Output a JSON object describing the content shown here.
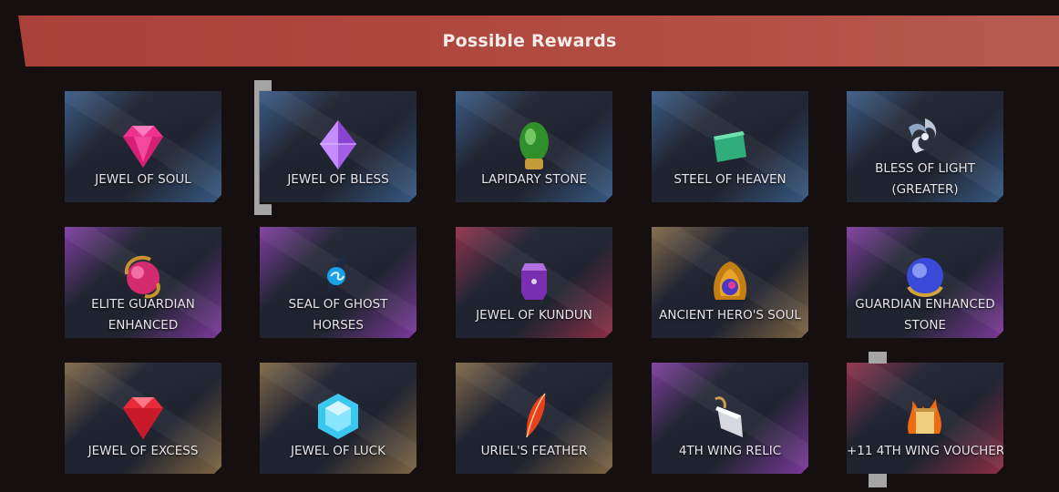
{
  "header": {
    "title": "Possible Rewards"
  },
  "rewards": [
    {
      "name": "JEWEL OF SOUL",
      "icon": "pink-diamond-icon",
      "tint": "#3d6aa0"
    },
    {
      "name": "JEWEL OF BLESS",
      "icon": "purple-crystal-icon",
      "tint": "#3d6aa0"
    },
    {
      "name": "LAPIDARY STONE",
      "icon": "green-egg-stone-icon",
      "tint": "#3d6aa0"
    },
    {
      "name": "STEEL OF HEAVEN",
      "icon": "green-cube-icon",
      "tint": "#3d6aa0"
    },
    {
      "name": "BLESS OF LIGHT",
      "name2": "(GREATER)",
      "icon": "silver-swirl-icon",
      "tint": "#3d6aa0"
    },
    {
      "name": "ELITE GUARDIAN",
      "name2": "ENHANCED",
      "icon": "pink-orb-gold-icon",
      "tint": "#9a3fc0"
    },
    {
      "name": "SEAL OF GHOST",
      "name2": "HORSES",
      "icon": "blue-feather-seal-icon",
      "tint": "#9a3fc0"
    },
    {
      "name": "JEWEL OF KUNDUN",
      "icon": "purple-gem-box-icon",
      "tint": "#b0304e"
    },
    {
      "name": "ANCIENT HERO'S SOUL",
      "icon": "golden-relic-orb-icon",
      "tint": "#9c7a4a"
    },
    {
      "name": "GUARDIAN ENHANCED",
      "name2": "STONE",
      "icon": "blue-orb-gold-icon",
      "tint": "#9a3fc0"
    },
    {
      "name": "JEWEL OF EXCESS",
      "icon": "red-diamond-icon",
      "tint": "#9c7a4a"
    },
    {
      "name": "JEWEL OF LUCK",
      "icon": "cyan-hexagon-gem-icon",
      "tint": "#9c7a4a"
    },
    {
      "name": "URIEL'S FEATHER",
      "icon": "red-feather-icon",
      "tint": "#9c7a4a"
    },
    {
      "name": "4TH WING RELIC",
      "icon": "crystal-wing-relic-icon",
      "tint": "#9a3fc0"
    },
    {
      "name": "+11 4TH WING VOUCHER",
      "icon": "fire-scroll-icon",
      "tint": "#b0304e"
    }
  ]
}
